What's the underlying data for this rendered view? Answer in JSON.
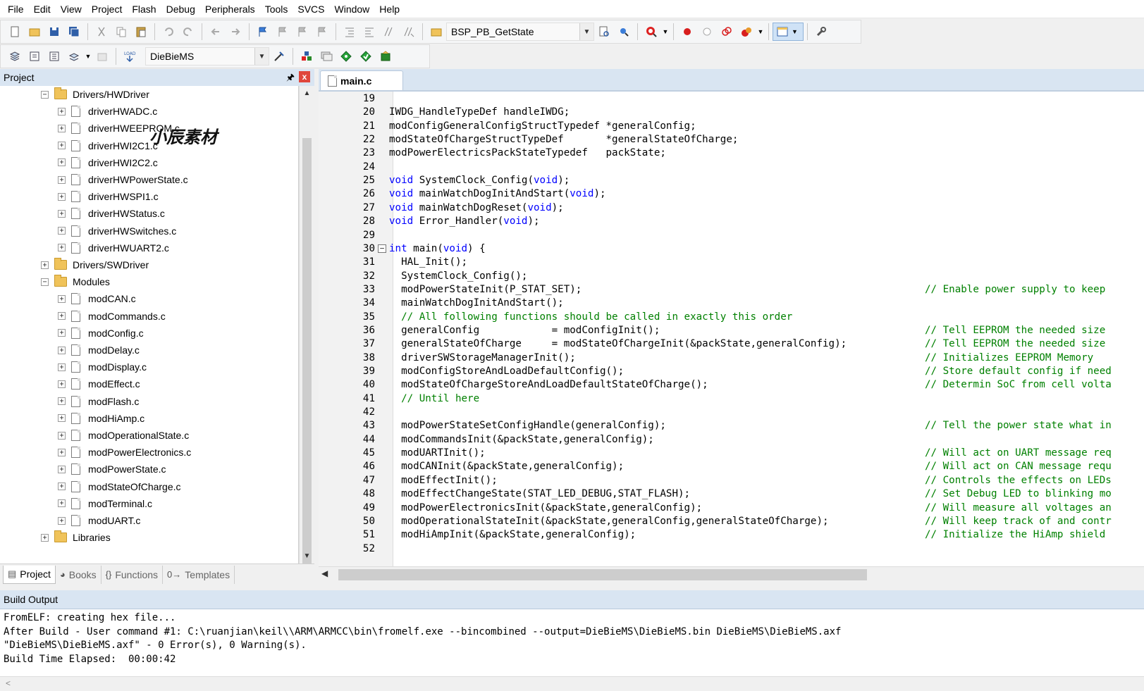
{
  "menu": [
    "File",
    "Edit",
    "View",
    "Project",
    "Flash",
    "Debug",
    "Peripherals",
    "Tools",
    "SVCS",
    "Window",
    "Help"
  ],
  "toolbar": {
    "function_combo": "BSP_PB_GetState",
    "target_combo": "DieBieMS"
  },
  "project_pane": {
    "title": "Project",
    "pin": "✂",
    "close": "x",
    "watermark": "小辰素材",
    "tree": [
      {
        "label": "Drivers/HWDriver",
        "type": "folder",
        "level": 1,
        "expander": "−"
      },
      {
        "label": "driverHWADC.c",
        "type": "file",
        "level": 2,
        "expander": "+"
      },
      {
        "label": "driverHWEEPROM.c",
        "type": "file",
        "level": 2,
        "expander": "+"
      },
      {
        "label": "driverHWI2C1.c",
        "type": "file",
        "level": 2,
        "expander": "+"
      },
      {
        "label": "driverHWI2C2.c",
        "type": "file",
        "level": 2,
        "expander": "+"
      },
      {
        "label": "driverHWPowerState.c",
        "type": "file",
        "level": 2,
        "expander": "+"
      },
      {
        "label": "driverHWSPI1.c",
        "type": "file",
        "level": 2,
        "expander": "+"
      },
      {
        "label": "driverHWStatus.c",
        "type": "file",
        "level": 2,
        "expander": "+"
      },
      {
        "label": "driverHWSwitches.c",
        "type": "file",
        "level": 2,
        "expander": "+"
      },
      {
        "label": "driverHWUART2.c",
        "type": "file",
        "level": 2,
        "expander": "+"
      },
      {
        "label": "Drivers/SWDriver",
        "type": "folder",
        "level": 1,
        "expander": "+"
      },
      {
        "label": "Modules",
        "type": "folder",
        "level": 1,
        "expander": "−"
      },
      {
        "label": "modCAN.c",
        "type": "file",
        "level": 2,
        "expander": "+"
      },
      {
        "label": "modCommands.c",
        "type": "file",
        "level": 2,
        "expander": "+"
      },
      {
        "label": "modConfig.c",
        "type": "file",
        "level": 2,
        "expander": "+"
      },
      {
        "label": "modDelay.c",
        "type": "file",
        "level": 2,
        "expander": "+"
      },
      {
        "label": "modDisplay.c",
        "type": "file",
        "level": 2,
        "expander": "+"
      },
      {
        "label": "modEffect.c",
        "type": "file",
        "level": 2,
        "expander": "+"
      },
      {
        "label": "modFlash.c",
        "type": "file",
        "level": 2,
        "expander": "+"
      },
      {
        "label": "modHiAmp.c",
        "type": "file",
        "level": 2,
        "expander": "+"
      },
      {
        "label": "modOperationalState.c",
        "type": "file",
        "level": 2,
        "expander": "+"
      },
      {
        "label": "modPowerElectronics.c",
        "type": "file",
        "level": 2,
        "expander": "+"
      },
      {
        "label": "modPowerState.c",
        "type": "file",
        "level": 2,
        "expander": "+"
      },
      {
        "label": "modStateOfCharge.c",
        "type": "file",
        "level": 2,
        "expander": "+"
      },
      {
        "label": "modTerminal.c",
        "type": "file",
        "level": 2,
        "expander": "+"
      },
      {
        "label": "modUART.c",
        "type": "file",
        "level": 2,
        "expander": "+"
      },
      {
        "label": "Libraries",
        "type": "folder",
        "level": 1,
        "expander": "+"
      }
    ],
    "tabs": [
      {
        "label": "Project",
        "icon": "▤",
        "active": true
      },
      {
        "label": "Books",
        "icon": "◕",
        "active": false
      },
      {
        "label": "Functions",
        "icon": "{}",
        "active": false
      },
      {
        "label": "Templates",
        "icon": "0→",
        "active": false
      }
    ]
  },
  "editor": {
    "tab_label": "main.c",
    "lines": [
      {
        "n": "19",
        "code": "",
        "comment": ""
      },
      {
        "n": "20",
        "code": "IWDG_HandleTypeDef handleIWDG;",
        "comment": ""
      },
      {
        "n": "21",
        "code": "modConfigGeneralConfigStructTypedef *generalConfig;",
        "comment": ""
      },
      {
        "n": "22",
        "code": "modStateOfChargeStructTypeDef       *generalStateOfCharge;",
        "comment": ""
      },
      {
        "n": "23",
        "code": "modPowerElectricsPackStateTypedef   packState;",
        "comment": ""
      },
      {
        "n": "24",
        "code": "",
        "comment": ""
      },
      {
        "n": "25",
        "code": "void SystemClock_Config(void);",
        "comment": ""
      },
      {
        "n": "26",
        "code": "void mainWatchDogInitAndStart(void);",
        "comment": ""
      },
      {
        "n": "27",
        "code": "void mainWatchDogReset(void);",
        "comment": ""
      },
      {
        "n": "28",
        "code": "void Error_Handler(void);",
        "comment": ""
      },
      {
        "n": "29",
        "code": "",
        "comment": ""
      },
      {
        "n": "30",
        "code": "int main(void) {",
        "comment": "",
        "fold": "−"
      },
      {
        "n": "31",
        "code": "  HAL_Init();",
        "comment": ""
      },
      {
        "n": "32",
        "code": "  SystemClock_Config();",
        "comment": ""
      },
      {
        "n": "33",
        "code": "  modPowerStateInit(P_STAT_SET);",
        "comment": "// Enable power supply to keep"
      },
      {
        "n": "34",
        "code": "  mainWatchDogInitAndStart();",
        "comment": ""
      },
      {
        "n": "35",
        "code": "  // All following functions should be called in exactly this order",
        "comment": "",
        "all_comment": true
      },
      {
        "n": "36",
        "code": "  generalConfig            = modConfigInit();",
        "comment": "// Tell EEPROM the needed size"
      },
      {
        "n": "37",
        "code": "  generalStateOfCharge     = modStateOfChargeInit(&packState,generalConfig);",
        "comment": "// Tell EEPROM the needed size"
      },
      {
        "n": "38",
        "code": "  driverSWStorageManagerInit();",
        "comment": "// Initializes EEPROM Memory"
      },
      {
        "n": "39",
        "code": "  modConfigStoreAndLoadDefaultConfig();",
        "comment": "// Store default config if need"
      },
      {
        "n": "40",
        "code": "  modStateOfChargeStoreAndLoadDefaultStateOfCharge();",
        "comment": "// Determin SoC from cell volta"
      },
      {
        "n": "41",
        "code": "  // Until here",
        "comment": "",
        "all_comment": true
      },
      {
        "n": "42",
        "code": "",
        "comment": ""
      },
      {
        "n": "43",
        "code": "  modPowerStateSetConfigHandle(generalConfig);",
        "comment": "// Tell the power state what in"
      },
      {
        "n": "44",
        "code": "  modCommandsInit(&packState,generalConfig);",
        "comment": ""
      },
      {
        "n": "45",
        "code": "  modUARTInit();",
        "comment": "// Will act on UART message req"
      },
      {
        "n": "46",
        "code": "  modCANInit(&packState,generalConfig);",
        "comment": "// Will act on CAN message requ"
      },
      {
        "n": "47",
        "code": "  modEffectInit();",
        "comment": "// Controls the effects on LEDs"
      },
      {
        "n": "48",
        "code": "  modEffectChangeState(STAT_LED_DEBUG,STAT_FLASH);",
        "comment": "// Set Debug LED to blinking mo"
      },
      {
        "n": "49",
        "code": "  modPowerElectronicsInit(&packState,generalConfig);",
        "comment": "// Will measure all voltages an"
      },
      {
        "n": "50",
        "code": "  modOperationalStateInit(&packState,generalConfig,generalStateOfCharge);",
        "comment": "// Will keep track of and contr"
      },
      {
        "n": "51",
        "code": "  modHiAmpInit(&packState,generalConfig);",
        "comment": "// Initialize the HiAmp shield"
      },
      {
        "n": "52",
        "code": "",
        "comment": ""
      }
    ]
  },
  "build_output": {
    "title": "Build Output",
    "lines": [
      "FromELF: creating hex file...",
      "After Build - User command #1: C:\\ruanjian\\keil\\\\ARM\\ARMCC\\bin\\fromelf.exe --bincombined --output=DieBieMS\\DieBieMS.bin DieBieMS\\DieBieMS.axf",
      "\"DieBieMS\\DieBieMS.axf\" - 0 Error(s), 0 Warning(s).",
      "Build Time Elapsed:  00:00:42"
    ],
    "scroll_left": "<"
  },
  "colors": {
    "keyword": "#0000ff",
    "comment": "#008000",
    "pane_header": "#d9e5f2"
  }
}
